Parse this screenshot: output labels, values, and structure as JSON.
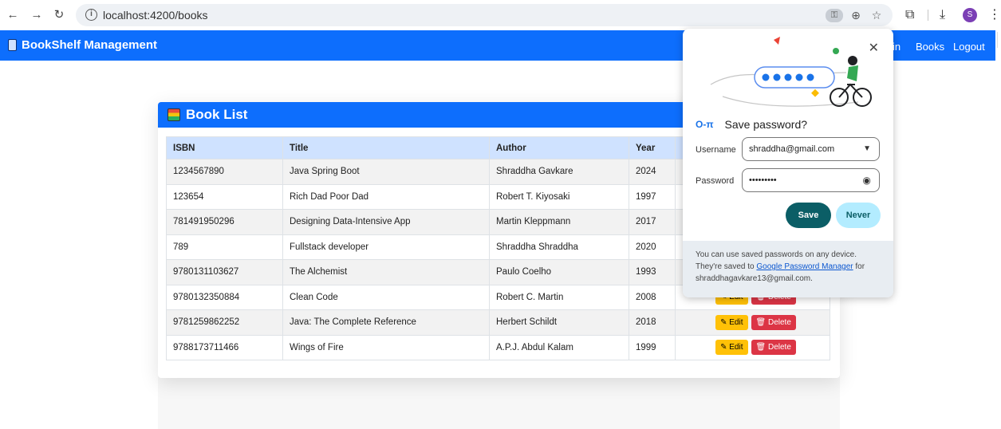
{
  "browser": {
    "url": "localhost:4200/books",
    "profile_initial": "S"
  },
  "navbar": {
    "brand": "BookShelf Management",
    "links": [
      "in",
      "Books",
      "Logout"
    ]
  },
  "card": {
    "title": "Book List",
    "columns": [
      "ISBN",
      "Title",
      "Author",
      "Year"
    ],
    "rows": [
      {
        "isbn": "1234567890",
        "title": "Java Spring Boot",
        "author": "Shraddha Gavkare",
        "year": "2024"
      },
      {
        "isbn": "123654",
        "title": "Rich Dad Poor Dad",
        "author": "Robert T. Kiyosaki",
        "year": "1997"
      },
      {
        "isbn": "781491950296",
        "title": "Designing Data-Intensive App",
        "author": "Martin Kleppmann",
        "year": "2017"
      },
      {
        "isbn": "789",
        "title": "Fullstack developer",
        "author": "Shraddha Shraddha",
        "year": "2020"
      },
      {
        "isbn": "9780131103627",
        "title": "The Alchemist",
        "author": "Paulo Coelho",
        "year": "1993"
      },
      {
        "isbn": "9780132350884",
        "title": "Clean Code",
        "author": "Robert C. Martin",
        "year": "2008"
      },
      {
        "isbn": "9781259862252",
        "title": "Java: The Complete Reference",
        "author": "Herbert Schildt",
        "year": "2018"
      },
      {
        "isbn": "9788173711466",
        "title": "Wings of Fire",
        "author": "A.P.J. Abdul Kalam",
        "year": "1999"
      }
    ],
    "edit_label": "Edit",
    "delete_label": "Delete"
  },
  "password_popup": {
    "title": "Save password?",
    "username_label": "Username",
    "username_value": "shraddha@gmail.com",
    "password_label": "Password",
    "password_value": "•••••••••",
    "save_label": "Save",
    "never_label": "Never",
    "footer_text_1": "You can use saved passwords on any device. They're saved to ",
    "footer_link": "Google Password Manager",
    "footer_text_2": " for shraddhagavkare13@gmail.com."
  },
  "colors": {
    "primary": "#0d6efd",
    "edit": "#ffc107",
    "delete": "#dc3545",
    "save": "#0b5e66",
    "never": "#b3ecff"
  }
}
